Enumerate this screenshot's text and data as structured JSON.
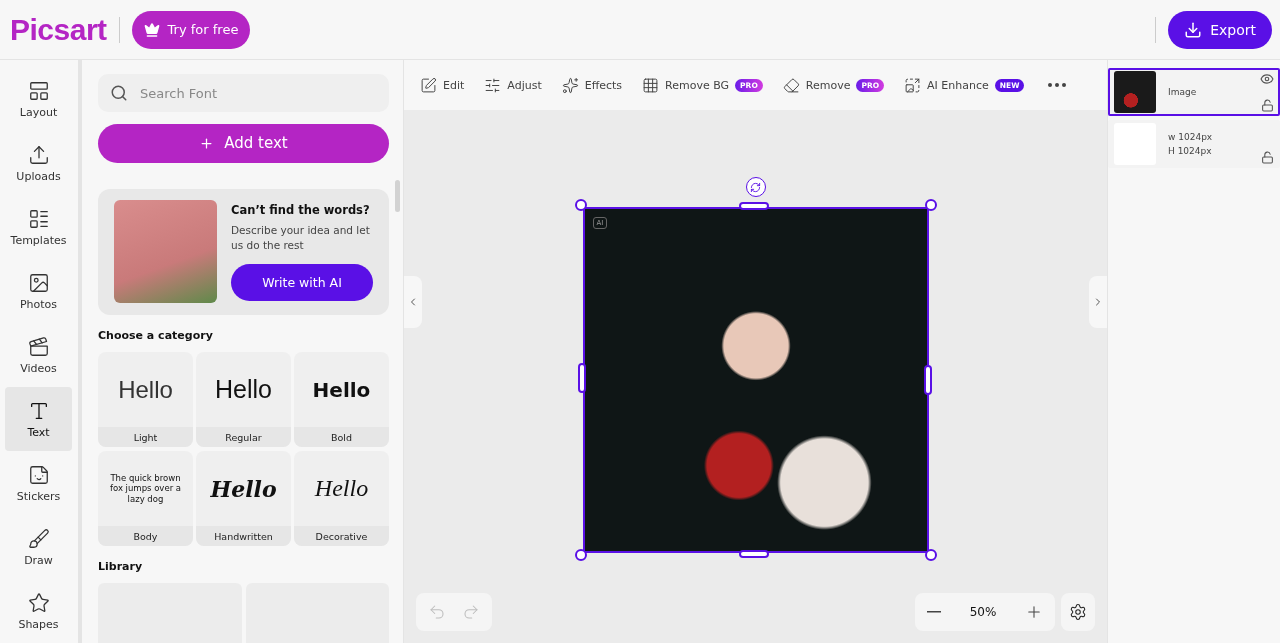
{
  "header": {
    "logo": "Picsart",
    "trial_button": "Try for free",
    "export_button": "Export"
  },
  "rail": [
    {
      "label": "Layout",
      "selected": false
    },
    {
      "label": "Uploads",
      "selected": false
    },
    {
      "label": "Templates",
      "selected": false
    },
    {
      "label": "Photos",
      "selected": false
    },
    {
      "label": "Videos",
      "selected": false
    },
    {
      "label": "Text",
      "selected": true
    },
    {
      "label": "Stickers",
      "selected": false
    },
    {
      "label": "Draw",
      "selected": false
    },
    {
      "label": "Shapes",
      "selected": false
    }
  ],
  "panel": {
    "search": {
      "placeholder": "Search Font"
    },
    "add_button": "Add text",
    "promo": {
      "title": "Can’t find the words?",
      "text": "Describe your idea and let us do the rest",
      "button": "Write with AI"
    },
    "category_heading": "Choose a category",
    "categories": [
      {
        "label": "Light",
        "kind": "light",
        "sample": "Hello"
      },
      {
        "label": "Regular",
        "kind": "regular",
        "sample": "Hello"
      },
      {
        "label": "Bold",
        "kind": "bold",
        "sample": "Hello"
      },
      {
        "label": "Body",
        "kind": "body",
        "sample": "The quick brown fox jumps over a lazy dog"
      },
      {
        "label": "Handwritten",
        "kind": "handwritten",
        "sample": "Hello"
      },
      {
        "label": "Decorative",
        "kind": "decorative",
        "sample": "Hello"
      }
    ],
    "library_heading": "Library"
  },
  "toolbar": [
    {
      "label": "Edit"
    },
    {
      "label": "Adjust"
    },
    {
      "label": "Effects"
    },
    {
      "label": "Remove BG",
      "kind": "pro",
      "badge": "PRO"
    },
    {
      "label": "Remove",
      "kind": "pro",
      "badge": "PRO"
    },
    {
      "label": "AI Enhance",
      "kind": "new",
      "badge": "NEW"
    }
  ],
  "canvas": {
    "ai_tag": "AI",
    "zoom": "50%",
    "undo": {
      "disabled": true
    },
    "redo": {
      "disabled": true
    }
  },
  "layers": [
    {
      "kind": "image",
      "label": "Image",
      "selected": true
    },
    {
      "kind": "background",
      "width": "w 1024px",
      "height": "H 1024px",
      "selected": false
    }
  ]
}
